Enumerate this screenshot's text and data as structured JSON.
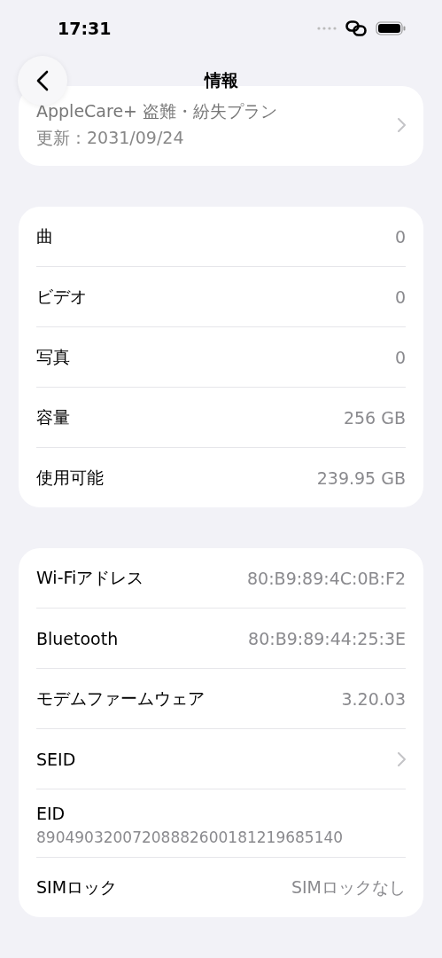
{
  "status_bar": {
    "time": "17:31"
  },
  "nav": {
    "title": "情報"
  },
  "plan": {
    "title": "AppleCare+ 盗難・紛失プラン",
    "subtitle": "更新：2031/09/24"
  },
  "sections": [
    {
      "rows": [
        {
          "kind": "value",
          "label": "曲",
          "value": "0"
        },
        {
          "kind": "value",
          "label": "ビデオ",
          "value": "0"
        },
        {
          "kind": "value",
          "label": "写真",
          "value": "0"
        },
        {
          "kind": "value",
          "label": "容量",
          "value": "256 GB"
        },
        {
          "kind": "value",
          "label": "使用可能",
          "value": "239.95 GB"
        }
      ]
    },
    {
      "rows": [
        {
          "kind": "value",
          "label": "Wi-Fiアドレス",
          "value": "80:B9:89:4C:0B:F2"
        },
        {
          "kind": "value",
          "label": "Bluetooth",
          "value": "80:B9:89:44:25:3E"
        },
        {
          "kind": "value",
          "label": "モデムファームウェア",
          "value": "3.20.03"
        },
        {
          "kind": "link",
          "label": "SEID"
        },
        {
          "kind": "stacked",
          "label": "EID",
          "value": "89049032007208882600181219685140"
        },
        {
          "kind": "value",
          "label": "SIMロック",
          "value": "SIMロックなし"
        }
      ]
    }
  ]
}
